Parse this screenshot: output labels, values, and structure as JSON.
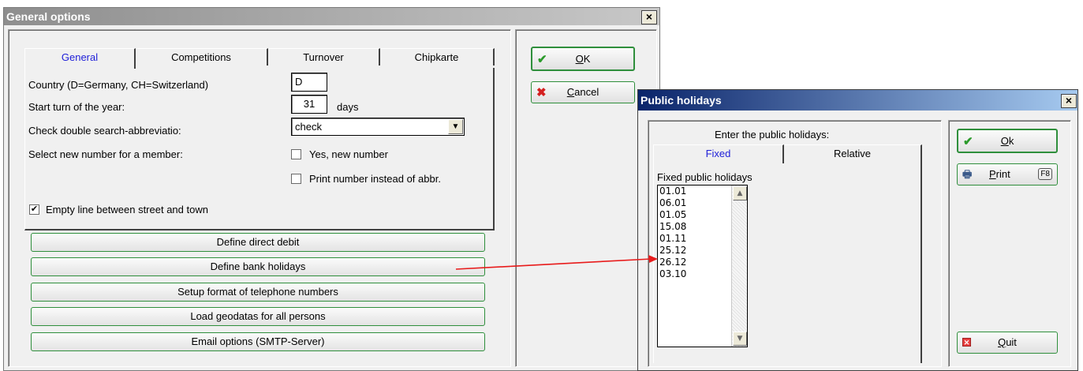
{
  "general_options": {
    "title": "General options",
    "close_glyph": "×",
    "tabs": [
      {
        "label": "General"
      },
      {
        "label": "Competitions"
      },
      {
        "label": "Turnover"
      },
      {
        "label": "Chipkarte"
      }
    ],
    "country_label": "Country (D=Germany, CH=Switzerland)",
    "country_value": "D",
    "start_turn_label": "Start turn of the year:",
    "start_turn_value": "31",
    "start_turn_unit": "days",
    "double_search_label": "Check double search-abbreviatio:",
    "double_search_value": "check",
    "new_number_label": "Select new number for a member:",
    "yes_new_number": "Yes, new number",
    "yes_new_number_checked": false,
    "print_number": "Print number instead of abbr.",
    "print_number_checked": false,
    "empty_line": "Empty line between street and town",
    "empty_line_checked": true,
    "action_buttons": [
      "Define direct debit",
      "Define bank holidays",
      "Setup format of telephone numbers",
      "Load geodatas for all persons",
      "Email options (SMTP-Server)"
    ],
    "ok": {
      "letter": "O",
      "rest": "K"
    },
    "cancel": {
      "letter": "C",
      "rest": "ancel"
    }
  },
  "public_holidays": {
    "title": "Public holidays",
    "close_glyph": "×",
    "header": "Enter the public holidays:",
    "tabs": [
      {
        "label": "Fixed"
      },
      {
        "label": "Relative"
      }
    ],
    "list_label": "Fixed public holidays",
    "dates": [
      "01.01",
      "06.01",
      "01.05",
      "15.08",
      "01.11",
      "25.12",
      "26.12",
      "03.10"
    ],
    "ok": {
      "letter": "O",
      "rest": "k"
    },
    "print": {
      "letter": "P",
      "rest": "rint",
      "key": "F8"
    },
    "quit": {
      "letter": "Q",
      "rest": "uit"
    }
  },
  "colors": {
    "accent_tab_text": "#1e1ed8",
    "button_border": "#2f8f3c",
    "arrow": "#e81b1b"
  }
}
